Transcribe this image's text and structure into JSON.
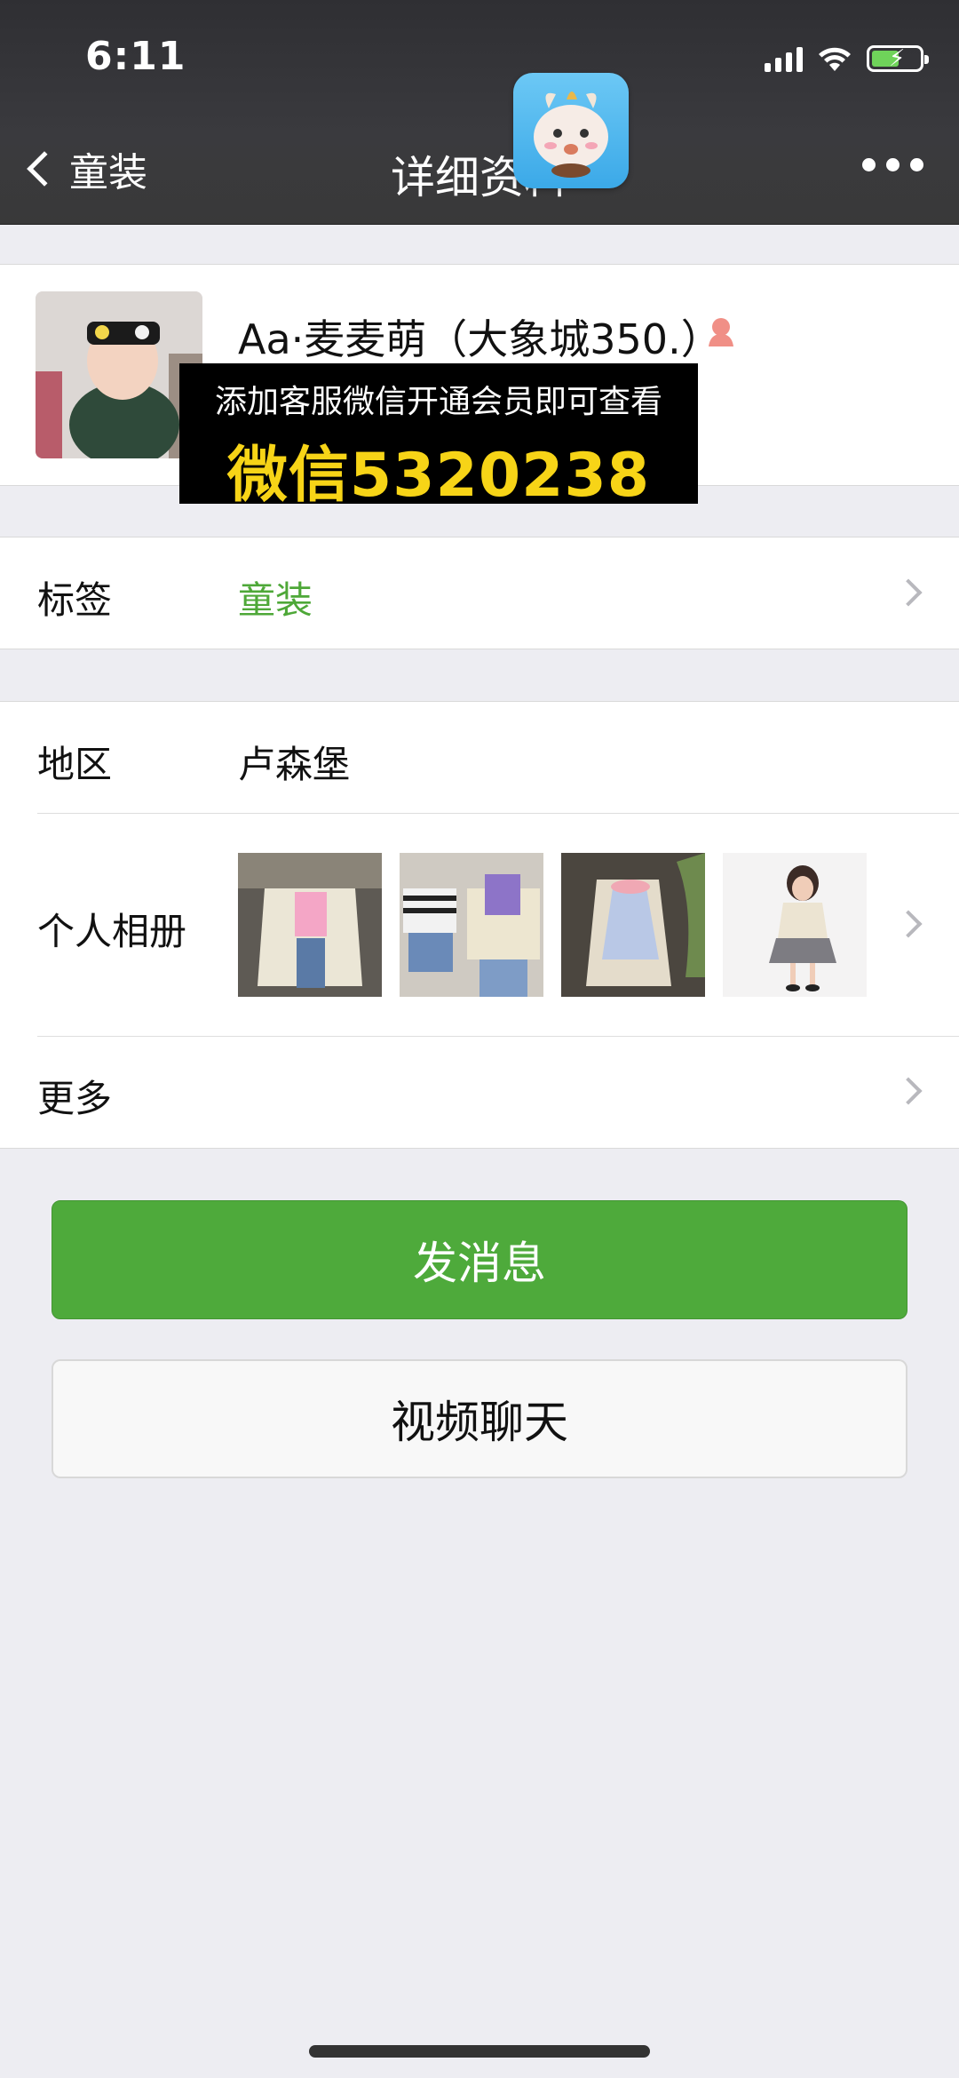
{
  "status_bar": {
    "time": "6:11"
  },
  "nav": {
    "back_label": "童装",
    "title": "详细资料"
  },
  "profile": {
    "name": "Aa·麦麦萌（大象城350.）"
  },
  "ad": {
    "line1": "添加客服微信开通会员即可查看",
    "line2": "微信5320238"
  },
  "tags": {
    "label": "标签",
    "value": "童装"
  },
  "region": {
    "label": "地区",
    "value": "卢森堡"
  },
  "album": {
    "label": "个人相册",
    "photo_count": 4
  },
  "more": {
    "label": "更多"
  },
  "buttons": {
    "send_message": "发消息",
    "video_chat": "视频聊天"
  },
  "colors": {
    "accent_green": "#4eaa3b",
    "tag_green": "#4ea838",
    "ad_yellow": "#f7d417",
    "header_bg": "#393939"
  },
  "icons": [
    "back-chevron-icon",
    "more-dots-icon",
    "signal-icon",
    "wifi-icon",
    "battery-icon",
    "female-icon",
    "chevron-right-icon"
  ]
}
